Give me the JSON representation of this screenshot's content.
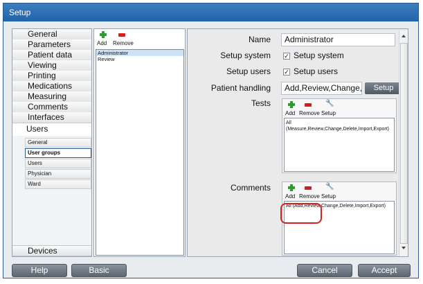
{
  "window": {
    "title": "Setup"
  },
  "nav": {
    "items": [
      "General",
      "Parameters",
      "Patient data",
      "Viewing",
      "Printing",
      "Medications",
      "Measuring",
      "Comments",
      "Interfaces",
      "Users"
    ],
    "sub_items": [
      "General",
      "User groups",
      "Users",
      "Physician",
      "Ward"
    ],
    "bottom_item": "Devices"
  },
  "list": {
    "add_label": "Add",
    "remove_label": "Remove",
    "rows": [
      "Administrator",
      "Review"
    ]
  },
  "detail": {
    "name_label": "Name",
    "name_value": "Administrator",
    "setup_system_label": "Setup system",
    "setup_system_check": "Setup system",
    "setup_users_label": "Setup users",
    "setup_users_check": "Setup users",
    "patient_handling_label": "Patient handling",
    "patient_handling_value": "Add,Review,Change,De",
    "setup_button": "Setup",
    "tests_label": "Tests",
    "tests_add": "Add",
    "tests_remove": "Remove",
    "tests_setup": "Setup",
    "tests_value": "All (Measure,Review,Change,Delete,Import,Export)",
    "comments_label": "Comments",
    "comments_add": "Add",
    "comments_remove": "Remove",
    "comments_setup": "Setup",
    "comments_value": "All (Add,Review,Change,Delete,Import,Export)"
  },
  "footer": {
    "help": "Help",
    "basic": "Basic",
    "cancel": "Cancel",
    "accept": "Accept"
  },
  "colors": {
    "title_bar": "#2264a8",
    "add_icon": "#2e9b2e",
    "remove_icon": "#d41c1c",
    "highlight": "#d62020"
  }
}
